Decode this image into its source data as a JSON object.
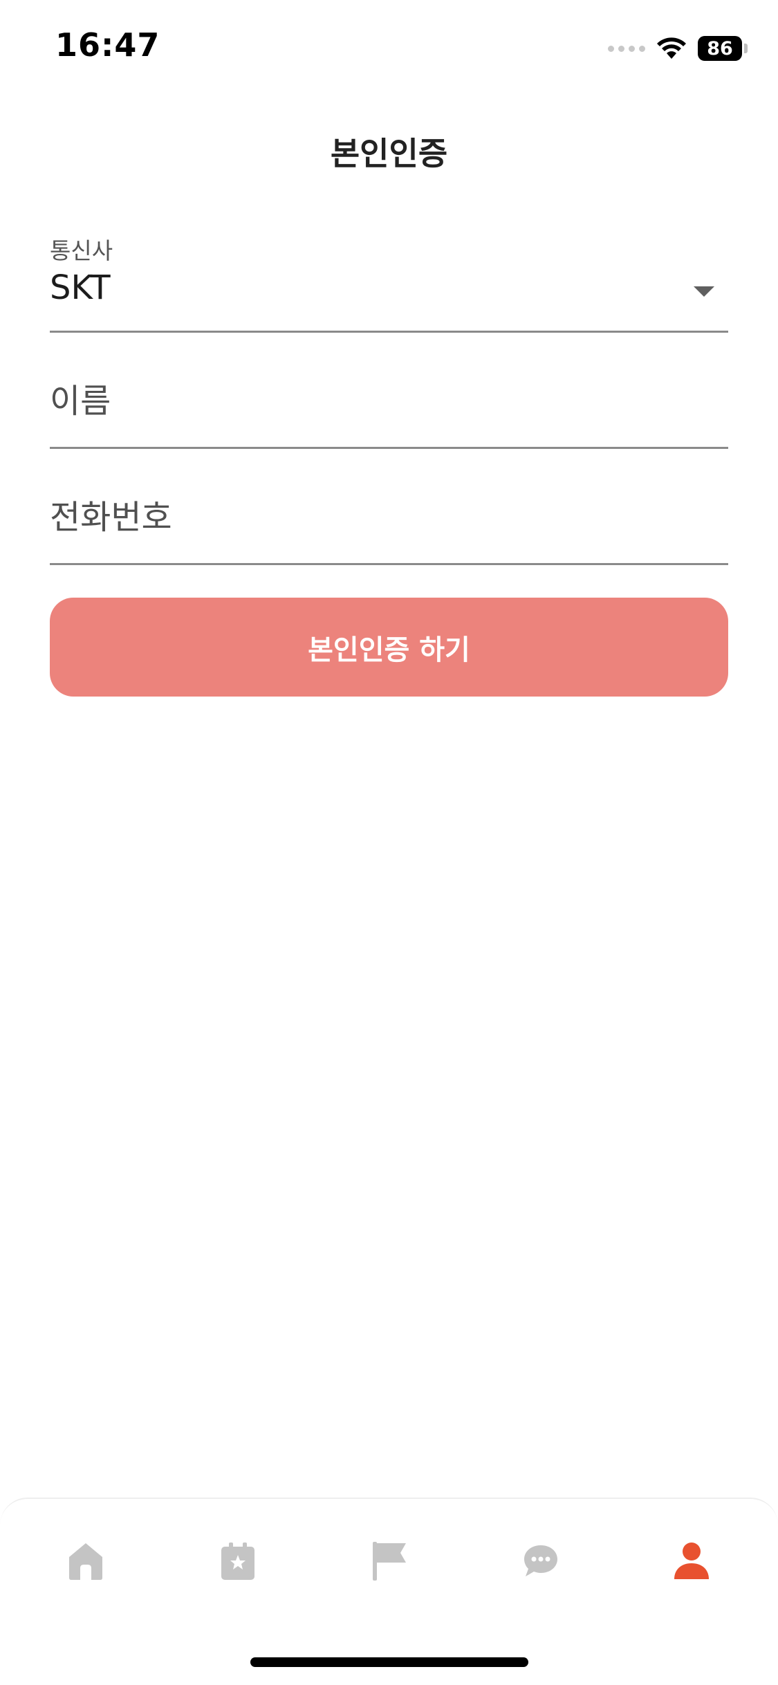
{
  "status_bar": {
    "time": "16:47",
    "battery": "86"
  },
  "header": {
    "title": "본인인증"
  },
  "form": {
    "carrier": {
      "label": "통신사",
      "value": "SKT"
    },
    "name": {
      "placeholder": "이름"
    },
    "phone": {
      "placeholder": "전화번호"
    },
    "submit_label": "본인인증 하기"
  },
  "tab_bar": {
    "items": [
      {
        "icon": "home-icon",
        "active": false
      },
      {
        "icon": "calendar-star-icon",
        "active": false
      },
      {
        "icon": "flag-icon",
        "active": false
      },
      {
        "icon": "chat-bubble-icon",
        "active": false
      },
      {
        "icon": "person-icon",
        "active": true
      }
    ],
    "colors": {
      "inactive": "#c4c4c4",
      "active": "#e8512f"
    }
  },
  "colors": {
    "button": "#ec837c",
    "divider": "#8a8a8a"
  }
}
